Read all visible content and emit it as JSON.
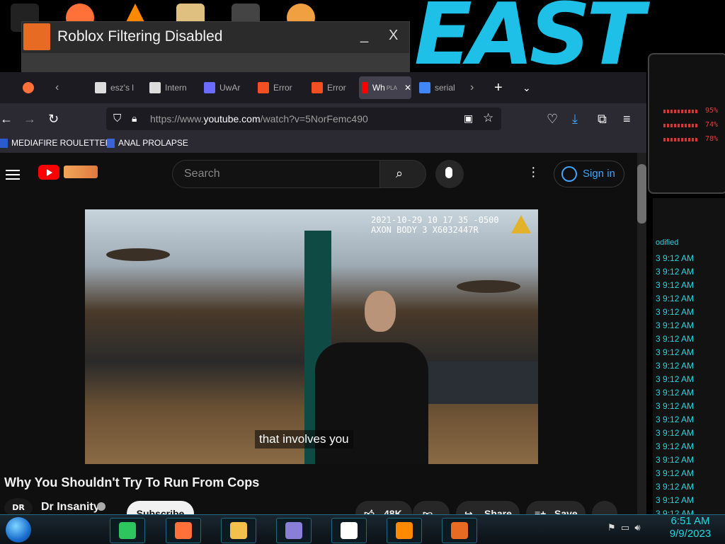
{
  "desktop": {
    "dialog": {
      "title": "Roblox Filtering Disabled",
      "minimize": "_",
      "close": "X"
    }
  },
  "hud": {
    "stats": [
      "95%",
      "74%",
      "78%"
    ]
  },
  "filelist": {
    "header": "odified",
    "rows": [
      "3 9:12 AM",
      "3 9:12 AM",
      "3 9:12 AM",
      "3 9:12 AM",
      "3 9:12 AM",
      "3 9:12 AM",
      "3 9:12 AM",
      "3 9:12 AM",
      "3 9:12 AM",
      "3 9:12 AM",
      "3 9:12 AM",
      "3 9:12 AM",
      "3 9:12 AM",
      "3 9:12 AM",
      "3 9:12 AM",
      "3 9:12 AM",
      "3 9:12 AM",
      "3 9:12 AM",
      "3 9:12 AM",
      "3 9:12 AM"
    ]
  },
  "browser": {
    "tabs": [
      {
        "label": "esz's l",
        "color": "#dddddd"
      },
      {
        "label": "Intern",
        "color": "#dddddd"
      },
      {
        "label": "UwAr",
        "color": "#6b6bff"
      },
      {
        "label": "Error",
        "color": "#f25022"
      },
      {
        "label": "Error",
        "color": "#f25022"
      },
      {
        "label": "Wh",
        "sub": "PLA",
        "color": "#ff0000",
        "active": true
      },
      {
        "label": "serial",
        "color": "#4285f4"
      }
    ],
    "url": {
      "prefix": "https://www.",
      "host": "youtube.com",
      "path": "/watch?v=5NorFemc490"
    },
    "bookmarks": [
      "MEDIAFIRE ROULETTER",
      "ANAL PROLAPSE"
    ]
  },
  "youtube": {
    "search_placeholder": "Search",
    "signin": "Sign in",
    "video": {
      "timestamp_line1": "2021-10-29 10 17 35 -0500",
      "timestamp_line2": "AXON BODY 3 X6032447R",
      "caption": "that involves you"
    },
    "title": "Why You Shouldn't Try To Run From Cops",
    "channel": {
      "avatar": "DR",
      "name": "Dr Insanity"
    },
    "subscribe": "Subscribe",
    "likes": "48K",
    "share": "Share",
    "save": "Save"
  },
  "taskbar": {
    "clock_time": "6:51 AM",
    "clock_date": "9/9/2023",
    "apps": [
      {
        "name": "chat-app",
        "color": "#2dc55e"
      },
      {
        "name": "firefox",
        "color": "#ff7139"
      },
      {
        "name": "file-explorer",
        "color": "#f3c14b"
      },
      {
        "name": "id-card",
        "color": "#8a7fd8"
      },
      {
        "name": "7zip",
        "color": "#ffffff"
      },
      {
        "name": "search",
        "color": "#ff8a00"
      },
      {
        "name": "app-orange",
        "color": "#e86b24"
      }
    ]
  }
}
